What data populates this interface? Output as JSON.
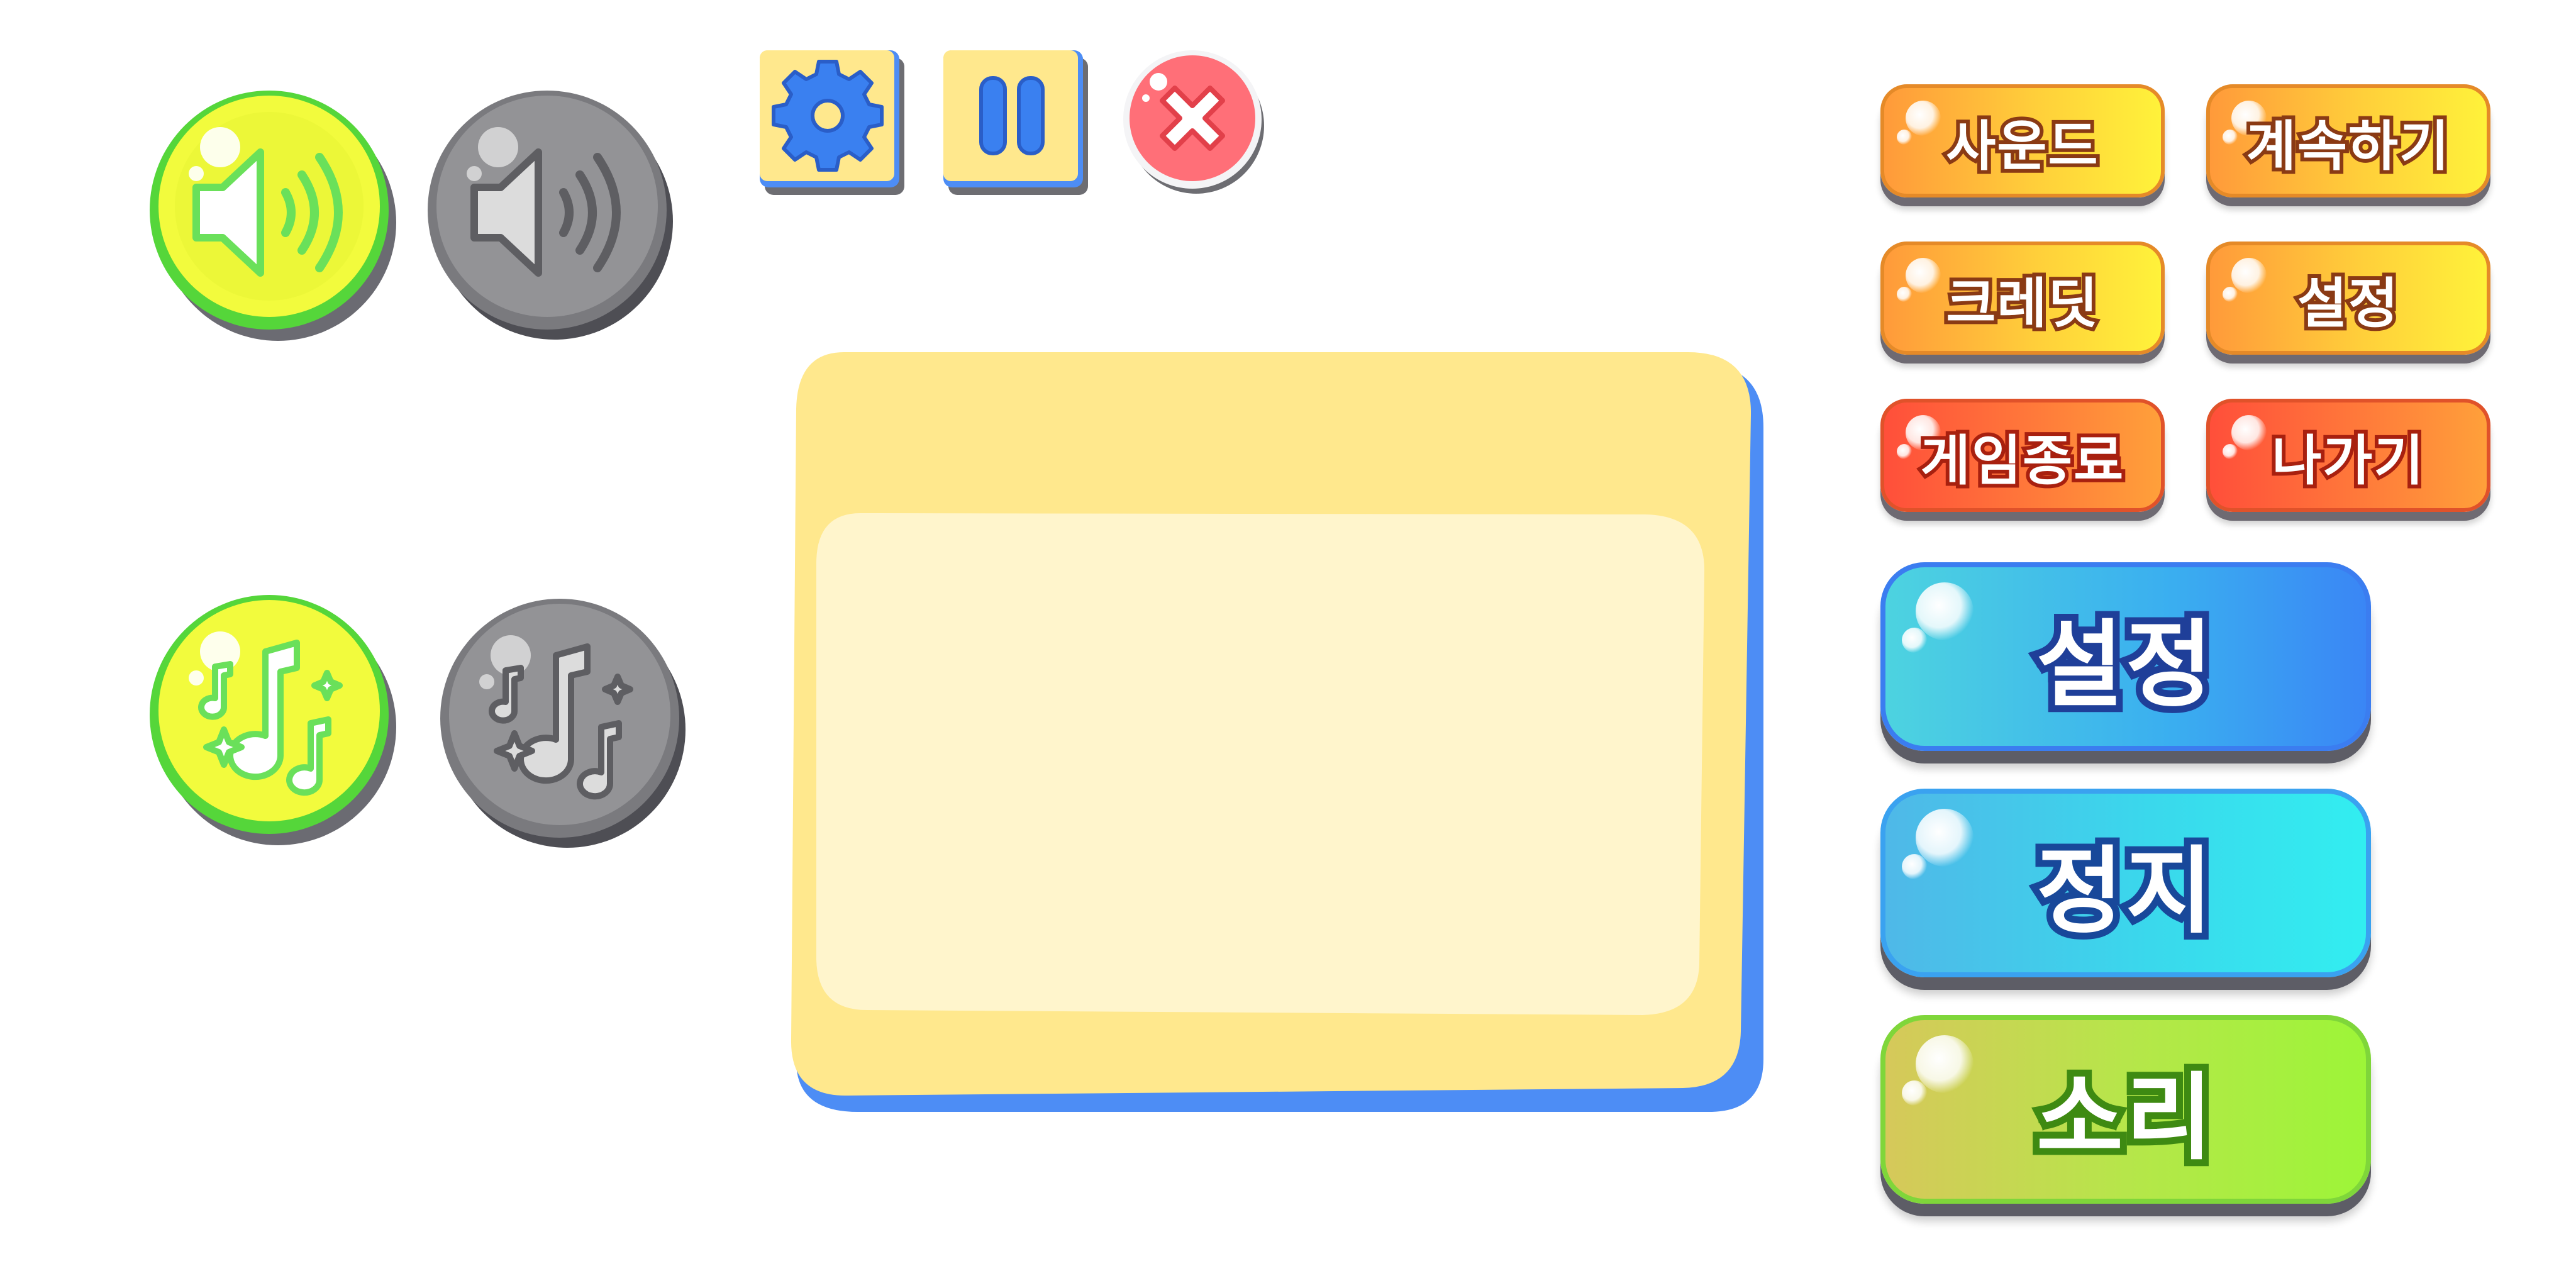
{
  "colors": {
    "active_fill": "#e6f53a",
    "active_rim": "#5fd83a",
    "inactive_fill": "#8a8a8a",
    "panel_fill": "#ffe88d",
    "panel_inner": "#fff5cc",
    "panel_shadow": "#4d8df5",
    "icon_blue": "#3a80f0",
    "close_red": "#ff6b6b"
  },
  "round_buttons": [
    {
      "name": "sound-on",
      "icon": "speaker-icon",
      "state": "on"
    },
    {
      "name": "sound-off",
      "icon": "speaker-icon",
      "state": "off"
    },
    {
      "name": "music-on",
      "icon": "music-notes-icon",
      "state": "on"
    },
    {
      "name": "music-off",
      "icon": "music-notes-icon",
      "state": "off"
    }
  ],
  "icon_buttons": [
    {
      "name": "settings",
      "icon": "gear-icon"
    },
    {
      "name": "pause",
      "icon": "pause-icon"
    },
    {
      "name": "close",
      "icon": "close-icon"
    }
  ],
  "pill_buttons": {
    "sound": "사운드",
    "continue": "계속하기",
    "credits": "크레딧",
    "settings": "설정",
    "quit_game": "게임종료",
    "exit": "나가기"
  },
  "big_buttons": {
    "settings": "설정",
    "stop": "정지",
    "sound": "소리"
  }
}
